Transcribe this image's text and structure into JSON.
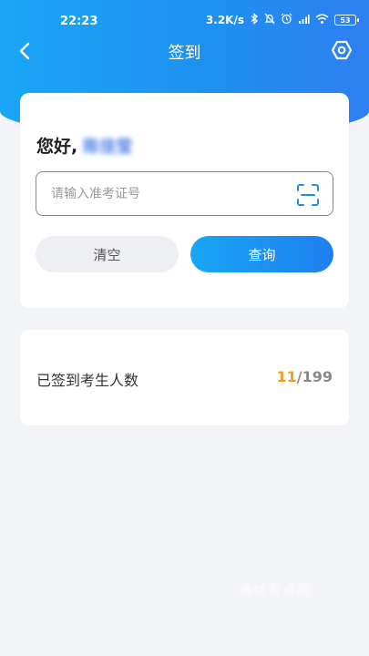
{
  "status_bar": {
    "time": "22:23",
    "network_speed": "3.2K/s",
    "battery_level": "53"
  },
  "nav": {
    "title": "签到",
    "back_icon": "back-arrow-icon",
    "settings_icon": "hexagon-gear-icon"
  },
  "query_card": {
    "greeting": "您好,",
    "user_name": "陈佳莹",
    "input_placeholder": "请输入准考证号",
    "input_value": "",
    "scan_icon": "scan-icon",
    "clear_label": "清空",
    "query_label": "查询"
  },
  "stats_card": {
    "label": "已签到考生人数",
    "checked_in": "11",
    "separator": "/",
    "total": "199"
  },
  "watermark": "潍坊安卓网",
  "colors": {
    "primary": "#1e8ff0",
    "accent": "#f0a020",
    "background": "#f3f4f8"
  }
}
